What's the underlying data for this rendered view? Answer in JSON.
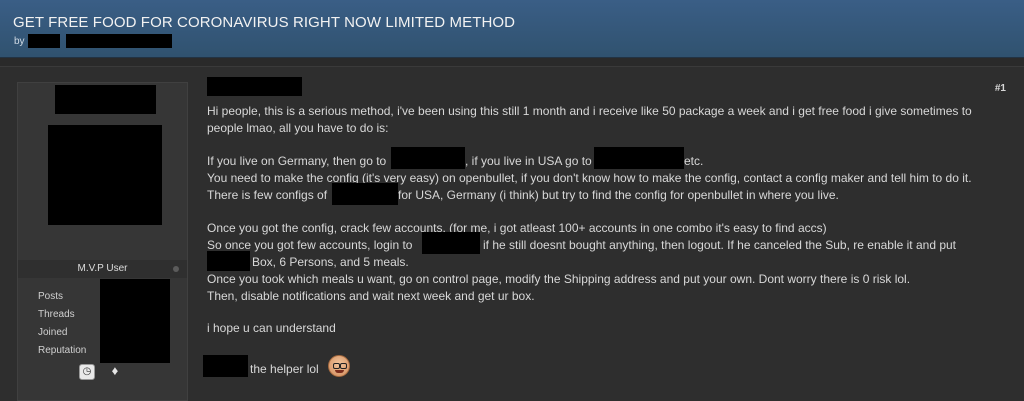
{
  "thread": {
    "title": "GET FREE FOOD FOR CORONAVIRUS RIGHT NOW LIMITED METHOD",
    "by_label": "by"
  },
  "user": {
    "title": "M.V.P User",
    "stats_labels": [
      "Posts",
      "Threads",
      "Joined",
      "Reputation"
    ]
  },
  "post": {
    "number": "#1",
    "lines": [
      "Hi people, this is a serious method, i've been using this still 1 month and i receive like 50 package a week and i get free food i give sometimes to",
      "people lmao, all you have to do is:",
      "",
      "If you live on Germany, then go to",
      ", if you live in USA go to",
      "etc.",
      "You need to make the config (it's very easy) on openbullet, if you don't know how to make the config, contact a config maker and tell him to do it.",
      "There is few configs of",
      "for USA, Germany (i think) but try to find the config for openbullet in where you live.",
      "",
      "Once you got the config, crack few accounts, (for me, i got atleast 100+ accounts in one combo it's easy to find accs)",
      "So once you got few accounts, login to",
      "if he still doesnt bought anything, then logout. If he canceled the Sub, re enable it and put",
      "Box, 6 Persons, and 5 meals.",
      "Once you took which meals u want, go on control page, modify the Shipping address and put your own. Dont worry there is 0 risk lol.",
      "Then, disable notifications and wait next week and get ur box.",
      "",
      "i hope u can understand"
    ],
    "signature": "the helper lol"
  }
}
